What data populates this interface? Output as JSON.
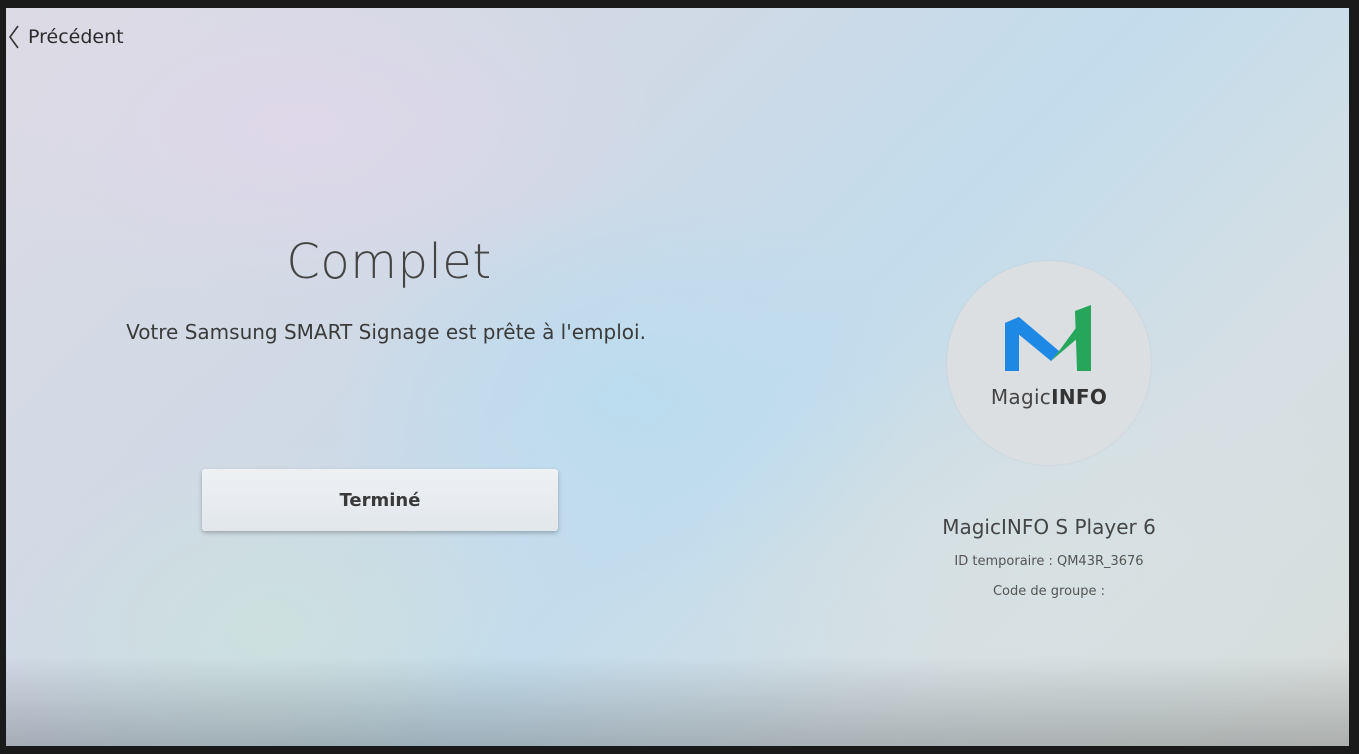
{
  "nav": {
    "back_label": "Précédent"
  },
  "main": {
    "title": "Complet",
    "subtitle": "Votre Samsung SMART Signage est prête à l'emploi.",
    "done_button": "Terminé"
  },
  "logo": {
    "brand_regular": "Magic",
    "brand_bold": "INFO",
    "colors": {
      "blue": "#1e88e5",
      "green": "#26a65b"
    }
  },
  "player": {
    "name": "MagicINFO S Player 6",
    "temp_id": "ID temporaire : QM43R_3676",
    "group_code": "Code de groupe :"
  },
  "icons": {
    "back": "chevron-left-icon",
    "logo": "magicinfo-logo-icon"
  }
}
